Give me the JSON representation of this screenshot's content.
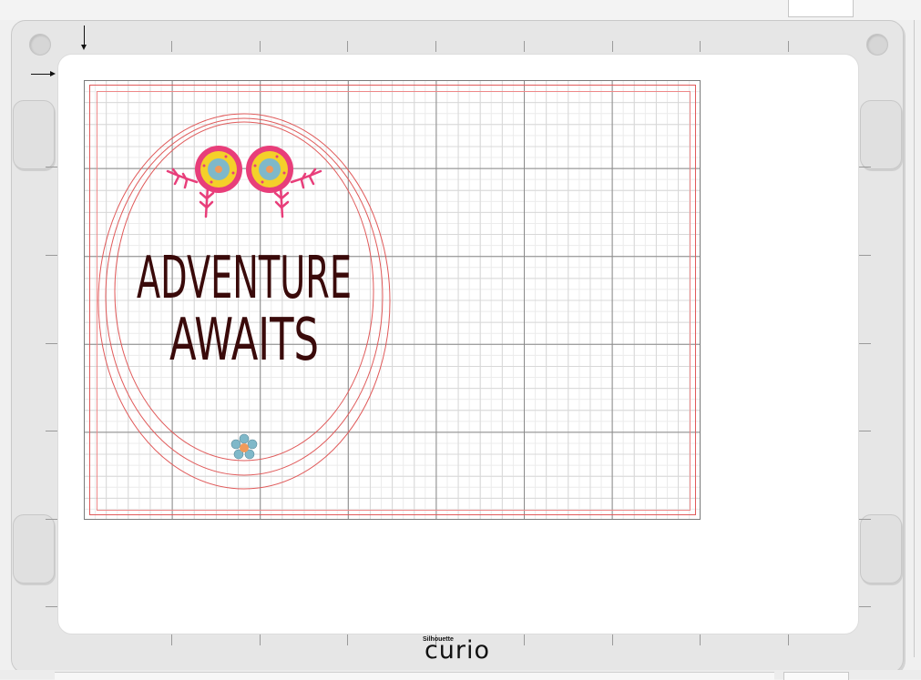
{
  "canvas": {
    "text_line1": "ADVENTURE",
    "text_line2": "AWAITS",
    "text_color": "#3a0a0a",
    "grid_major_color": "#8a8a8a",
    "grid_minor_color": "#d8d8d8",
    "cut_line_color": "#e05a5a"
  },
  "brand": {
    "small": "Silhouette",
    "big": "curio"
  }
}
